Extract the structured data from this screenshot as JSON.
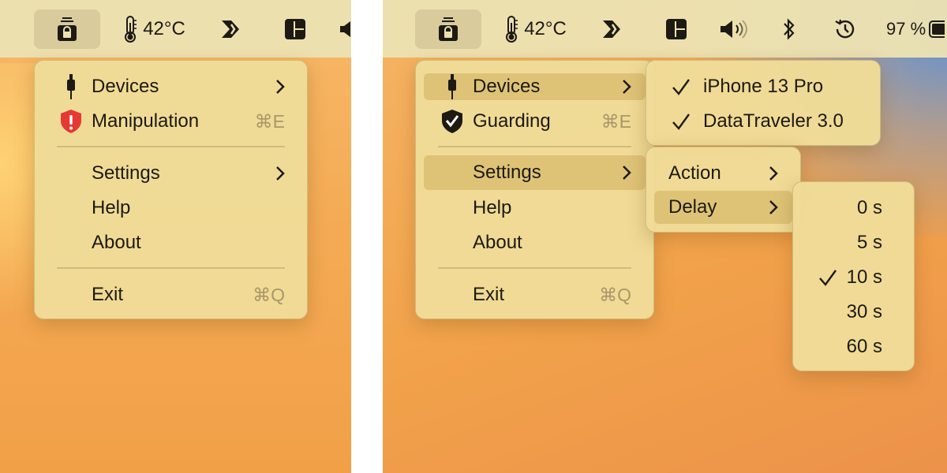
{
  "colors": {
    "menubar": "#ece2b2",
    "menu": "#f0dc98",
    "highlight": "#d4b464",
    "shield_red": "#e53935",
    "wallpaper": "#f2a047"
  },
  "left": {
    "menubar": {
      "temperature": "42°C"
    },
    "menu": {
      "devices": {
        "label": "Devices",
        "icon": "usb-cable-icon"
      },
      "status": {
        "label": "Manipulation",
        "icon": "red-shield-alert-icon",
        "shortcut": "⌘E"
      },
      "settings": {
        "label": "Settings"
      },
      "help": {
        "label": "Help"
      },
      "about": {
        "label": "About"
      },
      "exit": {
        "label": "Exit",
        "shortcut": "⌘Q"
      }
    }
  },
  "right": {
    "menubar": {
      "temperature": "42°C",
      "battery": "97 %"
    },
    "menu": {
      "devices": {
        "label": "Devices",
        "icon": "usb-cable-icon"
      },
      "status": {
        "label": "Guarding",
        "icon": "black-shield-check-icon",
        "shortcut": "⌘E"
      },
      "settings": {
        "label": "Settings"
      },
      "help": {
        "label": "Help"
      },
      "about": {
        "label": "About"
      },
      "exit": {
        "label": "Exit",
        "shortcut": "⌘Q"
      }
    },
    "devices_submenu": [
      {
        "label": "iPhone 13 Pro",
        "checked": true
      },
      {
        "label": "DataTraveler 3.0",
        "checked": true
      }
    ],
    "settings_submenu": [
      {
        "label": "Action"
      },
      {
        "label": "Delay"
      }
    ],
    "delay_submenu": [
      {
        "label": "0 s",
        "checked": false
      },
      {
        "label": "5 s",
        "checked": false
      },
      {
        "label": "10 s",
        "checked": true
      },
      {
        "label": "30 s",
        "checked": false
      },
      {
        "label": "60 s",
        "checked": false
      }
    ]
  }
}
